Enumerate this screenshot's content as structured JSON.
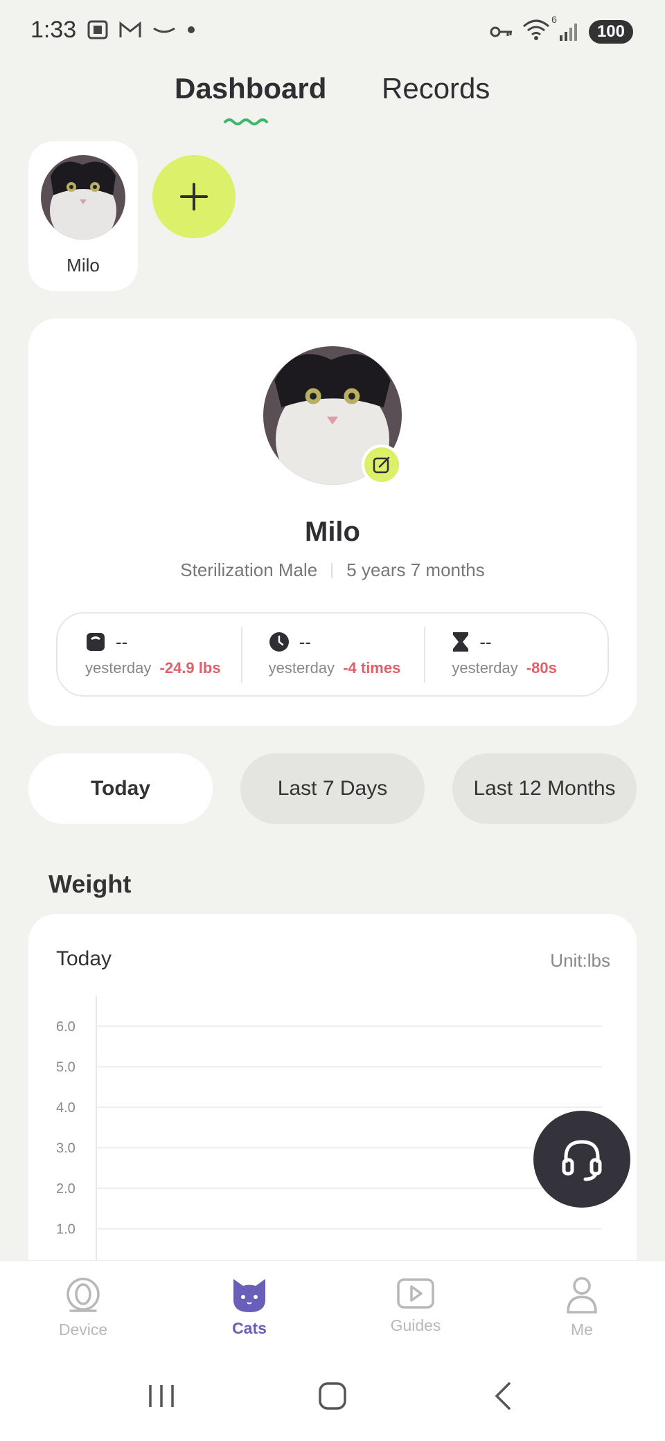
{
  "status_bar": {
    "time": "1:33",
    "battery": "100",
    "wifi_badge": "6",
    "icons": [
      "screenshot-icon",
      "gmail-icon",
      "amazon-icon",
      "dot-icon",
      "key-icon",
      "wifi-icon",
      "signal-icon"
    ]
  },
  "tabs": [
    {
      "label": "Dashboard",
      "active": true
    },
    {
      "label": "Records",
      "active": false
    }
  ],
  "cats": [
    {
      "name": "Milo"
    }
  ],
  "add_cat_icon": "plus-icon",
  "profile": {
    "name": "Milo",
    "status": "Sterilization Male",
    "age": "5 years 7 months",
    "stats": [
      {
        "icon": "scale-icon",
        "value": "--",
        "label": "yesterday",
        "delta": "-24.9 lbs"
      },
      {
        "icon": "clock-icon",
        "value": "--",
        "label": "yesterday",
        "delta": "-4 times"
      },
      {
        "icon": "hourglass-icon",
        "value": "--",
        "label": "yesterday",
        "delta": "-80s"
      }
    ]
  },
  "ranges": [
    {
      "label": "Today",
      "active": true
    },
    {
      "label": "Last 7 Days",
      "active": false
    },
    {
      "label": "Last 12 Months",
      "active": false
    }
  ],
  "weight": {
    "title": "Weight",
    "period": "Today",
    "unit": "Unit:lbs"
  },
  "chart_data": {
    "type": "line",
    "title": "",
    "xlabel": "",
    "ylabel": "",
    "y_ticks": [
      "6.0",
      "5.0",
      "4.0",
      "3.0",
      "2.0",
      "1.0"
    ],
    "ylim": [
      0,
      6
    ],
    "grid": true,
    "series": []
  },
  "bottom_nav": [
    {
      "label": "Device",
      "icon": "device-icon",
      "active": false
    },
    {
      "label": "Cats",
      "icon": "cat-icon",
      "active": true
    },
    {
      "label": "Guides",
      "icon": "play-icon",
      "active": false
    },
    {
      "label": "Me",
      "icon": "person-icon",
      "active": false
    }
  ],
  "colors": {
    "accent_lime": "#dcf06a",
    "accent_purple": "#6a5fb8",
    "delta_red": "#e06068",
    "tab_underline": "#3cb86a",
    "background": "#f2f2ee"
  }
}
